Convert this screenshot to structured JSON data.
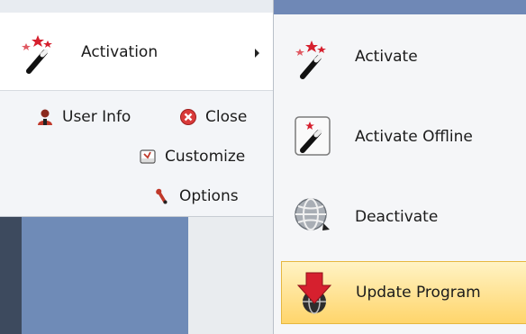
{
  "main_menu": {
    "activation": {
      "label": "Activation",
      "icon": "magic-wand-stars-icon"
    },
    "user_info": {
      "label": "User Info",
      "icon": "user-icon"
    },
    "close": {
      "label": "Close",
      "icon": "close-circle-icon"
    },
    "customize": {
      "label": "Customize",
      "icon": "customize-icon"
    },
    "options": {
      "label": "Options",
      "icon": "wrench-icon"
    }
  },
  "submenu": {
    "items": [
      {
        "label": "Activate",
        "icon": "magic-wand-stars-icon",
        "selected": false
      },
      {
        "label": "Activate Offline",
        "icon": "offline-wand-icon",
        "selected": false
      },
      {
        "label": "Deactivate",
        "icon": "globe-icon",
        "selected": false
      },
      {
        "label": "Update Program",
        "icon": "update-arrow-globe-icon",
        "selected": true
      }
    ]
  },
  "colors": {
    "highlight_top": "#fff3c4",
    "highlight_bottom": "#ffd56b",
    "panel_blue": "#6f8bb7"
  }
}
